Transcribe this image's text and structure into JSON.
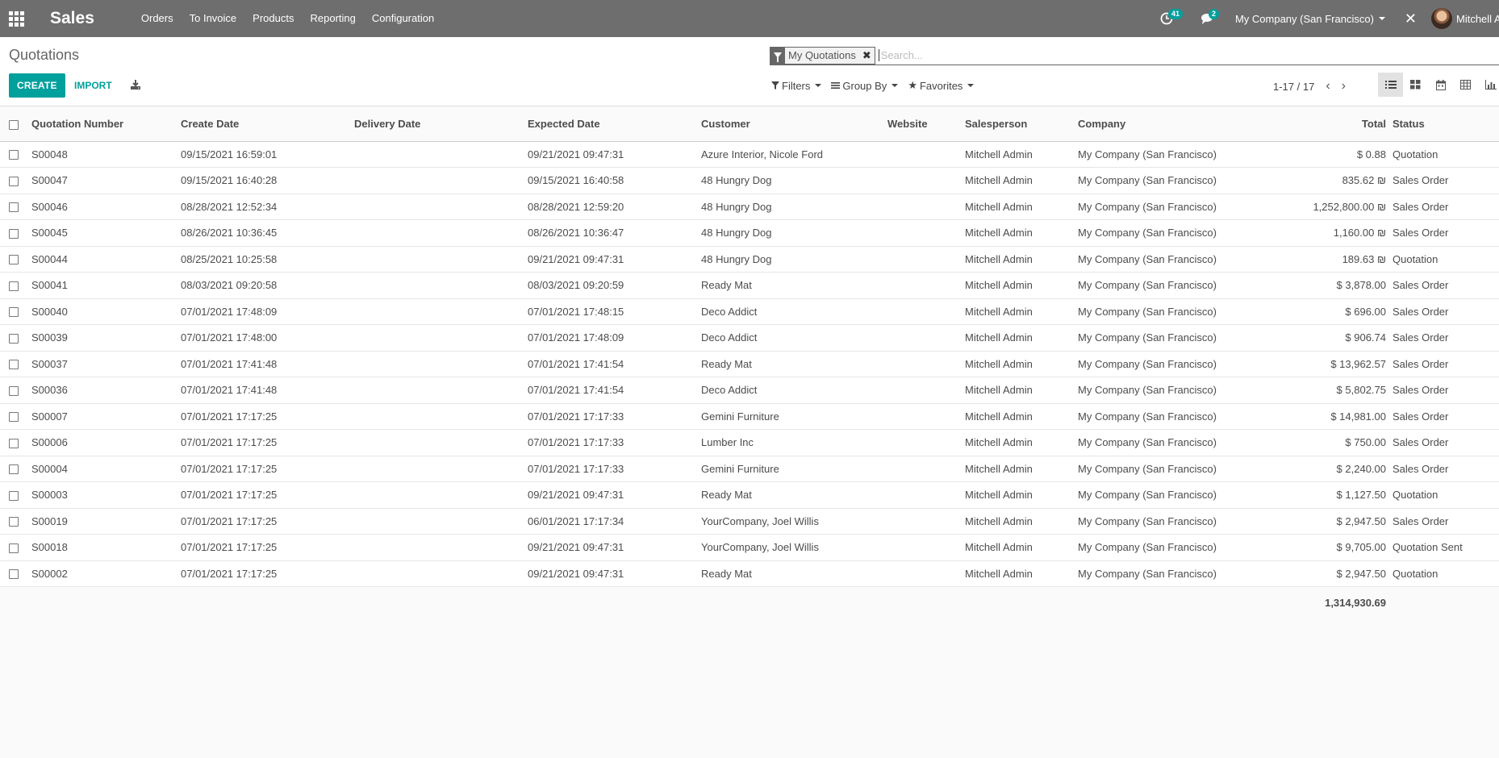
{
  "nav": {
    "brand": "Sales",
    "menu": [
      "Orders",
      "To Invoice",
      "Products",
      "Reporting",
      "Configuration"
    ],
    "activity_count": "41",
    "message_count": "2",
    "company": "My Company (San Francisco)",
    "user": "Mitchell Admin"
  },
  "control": {
    "title": "Quotations",
    "create_label": "CREATE",
    "import_label": "IMPORT",
    "facet_label": "My Quotations",
    "search_placeholder": "Search...",
    "filters_label": "Filters",
    "groupby_label": "Group By",
    "favorites_label": "Favorites",
    "pager": "1-17 / 17"
  },
  "table": {
    "columns": [
      "Quotation Number",
      "Create Date",
      "Delivery Date",
      "Expected Date",
      "Customer",
      "Website",
      "Salesperson",
      "Company",
      "Total",
      "Status"
    ],
    "rows": [
      [
        "S00048",
        "09/15/2021 16:59:01",
        "",
        "09/21/2021 09:47:31",
        "Azure Interior, Nicole Ford",
        "",
        "Mitchell Admin",
        "My Company (San Francisco)",
        "$ 0.88",
        "Quotation"
      ],
      [
        "S00047",
        "09/15/2021 16:40:28",
        "",
        "09/15/2021 16:40:58",
        "48 Hungry Dog",
        "",
        "Mitchell Admin",
        "My Company (San Francisco)",
        "835.62 ₪",
        "Sales Order"
      ],
      [
        "S00046",
        "08/28/2021 12:52:34",
        "",
        "08/28/2021 12:59:20",
        "48 Hungry Dog",
        "",
        "Mitchell Admin",
        "My Company (San Francisco)",
        "1,252,800.00 ₪",
        "Sales Order"
      ],
      [
        "S00045",
        "08/26/2021 10:36:45",
        "",
        "08/26/2021 10:36:47",
        "48 Hungry Dog",
        "",
        "Mitchell Admin",
        "My Company (San Francisco)",
        "1,160.00 ₪",
        "Sales Order"
      ],
      [
        "S00044",
        "08/25/2021 10:25:58",
        "",
        "09/21/2021 09:47:31",
        "48 Hungry Dog",
        "",
        "Mitchell Admin",
        "My Company (San Francisco)",
        "189.63 ₪",
        "Quotation"
      ],
      [
        "S00041",
        "08/03/2021 09:20:58",
        "",
        "08/03/2021 09:20:59",
        "Ready Mat",
        "",
        "Mitchell Admin",
        "My Company (San Francisco)",
        "$ 3,878.00",
        "Sales Order"
      ],
      [
        "S00040",
        "07/01/2021 17:48:09",
        "",
        "07/01/2021 17:48:15",
        "Deco Addict",
        "",
        "Mitchell Admin",
        "My Company (San Francisco)",
        "$ 696.00",
        "Sales Order"
      ],
      [
        "S00039",
        "07/01/2021 17:48:00",
        "",
        "07/01/2021 17:48:09",
        "Deco Addict",
        "",
        "Mitchell Admin",
        "My Company (San Francisco)",
        "$ 906.74",
        "Sales Order"
      ],
      [
        "S00037",
        "07/01/2021 17:41:48",
        "",
        "07/01/2021 17:41:54",
        "Ready Mat",
        "",
        "Mitchell Admin",
        "My Company (San Francisco)",
        "$ 13,962.57",
        "Sales Order"
      ],
      [
        "S00036",
        "07/01/2021 17:41:48",
        "",
        "07/01/2021 17:41:54",
        "Deco Addict",
        "",
        "Mitchell Admin",
        "My Company (San Francisco)",
        "$ 5,802.75",
        "Sales Order"
      ],
      [
        "S00007",
        "07/01/2021 17:17:25",
        "",
        "07/01/2021 17:17:33",
        "Gemini Furniture",
        "",
        "Mitchell Admin",
        "My Company (San Francisco)",
        "$ 14,981.00",
        "Sales Order"
      ],
      [
        "S00006",
        "07/01/2021 17:17:25",
        "",
        "07/01/2021 17:17:33",
        "Lumber Inc",
        "",
        "Mitchell Admin",
        "My Company (San Francisco)",
        "$ 750.00",
        "Sales Order"
      ],
      [
        "S00004",
        "07/01/2021 17:17:25",
        "",
        "07/01/2021 17:17:33",
        "Gemini Furniture",
        "",
        "Mitchell Admin",
        "My Company (San Francisco)",
        "$ 2,240.00",
        "Sales Order"
      ],
      [
        "S00003",
        "07/01/2021 17:17:25",
        "",
        "09/21/2021 09:47:31",
        "Ready Mat",
        "",
        "Mitchell Admin",
        "My Company (San Francisco)",
        "$ 1,127.50",
        "Quotation"
      ],
      [
        "S00019",
        "07/01/2021 17:17:25",
        "",
        "06/01/2021 17:17:34",
        "YourCompany, Joel Willis",
        "",
        "Mitchell Admin",
        "My Company (San Francisco)",
        "$ 2,947.50",
        "Sales Order"
      ],
      [
        "S00018",
        "07/01/2021 17:17:25",
        "",
        "09/21/2021 09:47:31",
        "YourCompany, Joel Willis",
        "",
        "Mitchell Admin",
        "My Company (San Francisco)",
        "$ 9,705.00",
        "Quotation Sent"
      ],
      [
        "S00002",
        "07/01/2021 17:17:25",
        "",
        "09/21/2021 09:47:31",
        "Ready Mat",
        "",
        "Mitchell Admin",
        "My Company (San Francisco)",
        "$ 2,947.50",
        "Quotation"
      ]
    ],
    "grand_total": "1,314,930.69"
  },
  "colors": {
    "navbar": "#6f6e6e",
    "accent": "#00a09d"
  }
}
